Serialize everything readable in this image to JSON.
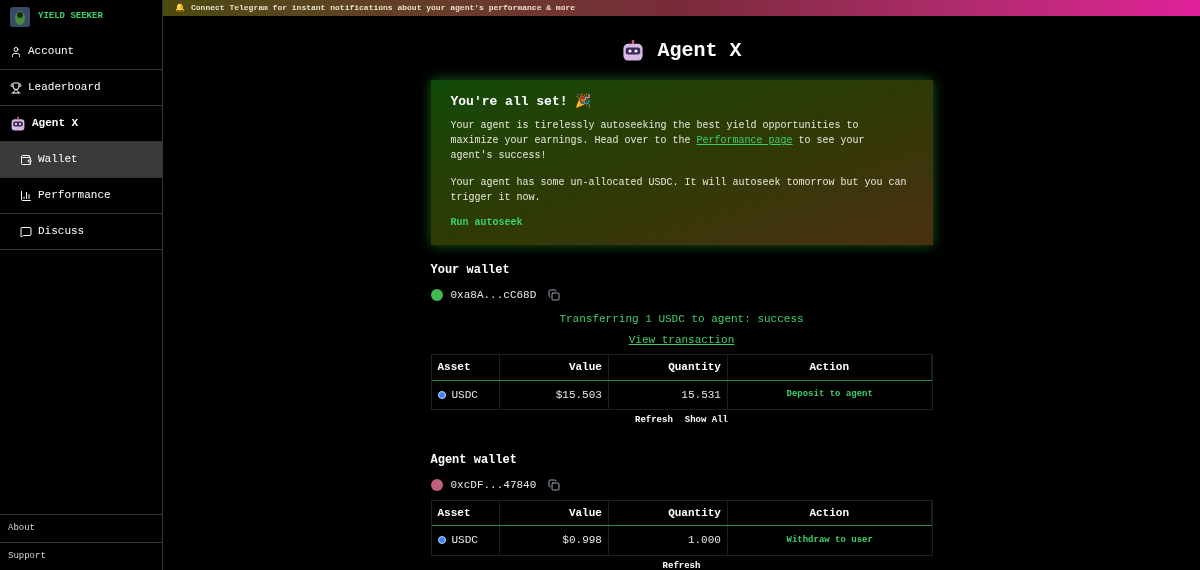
{
  "sidebar": {
    "brand": "YIELD SEEKER",
    "items": [
      {
        "label": "Account",
        "selected": false,
        "sub": false
      },
      {
        "label": "Leaderboard",
        "selected": false,
        "sub": false
      },
      {
        "label": "Agent X",
        "selected": false,
        "sub": false
      },
      {
        "label": "Wallet",
        "selected": true,
        "sub": true
      },
      {
        "label": "Performance",
        "selected": false,
        "sub": true
      },
      {
        "label": "Discuss",
        "selected": false,
        "sub": true
      }
    ],
    "footer": [
      "About",
      "Support"
    ]
  },
  "banner": {
    "icon": "🔔",
    "text": "Connect Telegram for instant notifications about your agent's performance & more"
  },
  "page_title": "Agent X",
  "notice": {
    "title": "You're all set! 🎉",
    "text_before": "Your agent is tirelessly autoseeking the best yield opportunities to maximize your earnings. Head over to the ",
    "link": "Performance page",
    "text_after": " to see your agent's success!",
    "text2": "Your agent has some un-allocated USDC. It will autoseek tomorrow but you can trigger it now.",
    "action": "Run autoseek"
  },
  "wallets": [
    {
      "title": "Your wallet",
      "address": "0xa8A...cC68D",
      "status": "Transferring 1 USDC to agent: success",
      "status_link": "View transaction",
      "columns": [
        "Asset",
        "Value",
        "Quantity",
        "Action"
      ],
      "rows": [
        {
          "asset": "USDC",
          "value": "$15.503",
          "quantity": "15.531",
          "action": "Deposit to agent"
        }
      ],
      "buttons": [
        "Refresh",
        "Show All"
      ]
    },
    {
      "title": "Agent wallet",
      "address": "0xcDF...47840",
      "columns": [
        "Asset",
        "Value",
        "Quantity",
        "Action"
      ],
      "rows": [
        {
          "asset": "USDC",
          "value": "$0.998",
          "quantity": "1.000",
          "action": "Withdraw to user"
        }
      ],
      "buttons": [
        "Refresh"
      ]
    }
  ]
}
